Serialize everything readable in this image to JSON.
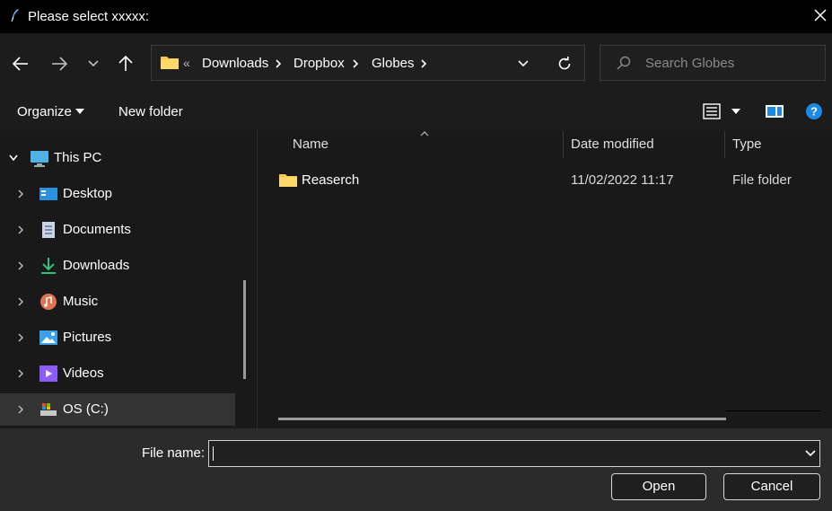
{
  "window": {
    "title": "Please select xxxxx:"
  },
  "address_bar": {
    "overflow": "«",
    "crumbs": [
      "Downloads",
      "Dropbox",
      "Globes"
    ]
  },
  "search": {
    "placeholder": "Search Globes"
  },
  "toolbar": {
    "organize_label": "Organize",
    "new_folder_label": "New folder"
  },
  "nav": {
    "root_label": "This PC",
    "items": [
      {
        "label": "Desktop",
        "icon": "desktop-icon"
      },
      {
        "label": "Documents",
        "icon": "documents-icon"
      },
      {
        "label": "Downloads",
        "icon": "downloads-icon"
      },
      {
        "label": "Music",
        "icon": "music-icon"
      },
      {
        "label": "Pictures",
        "icon": "pictures-icon"
      },
      {
        "label": "Videos",
        "icon": "videos-icon"
      },
      {
        "label": "OS (C:)",
        "icon": "drive-icon",
        "selected": true
      }
    ]
  },
  "files": {
    "columns": [
      "Name",
      "Date modified",
      "Type"
    ],
    "rows": [
      {
        "name": "Reaserch",
        "date": "11/02/2022 11:17",
        "type": "File folder"
      }
    ]
  },
  "bottom": {
    "file_name_label": "File name:",
    "file_name_value": "",
    "open_label": "Open",
    "cancel_label": "Cancel"
  },
  "colors": {
    "folder": "#f5c84b",
    "help": "#1a8ae5",
    "accent": "#3ca0ff"
  }
}
